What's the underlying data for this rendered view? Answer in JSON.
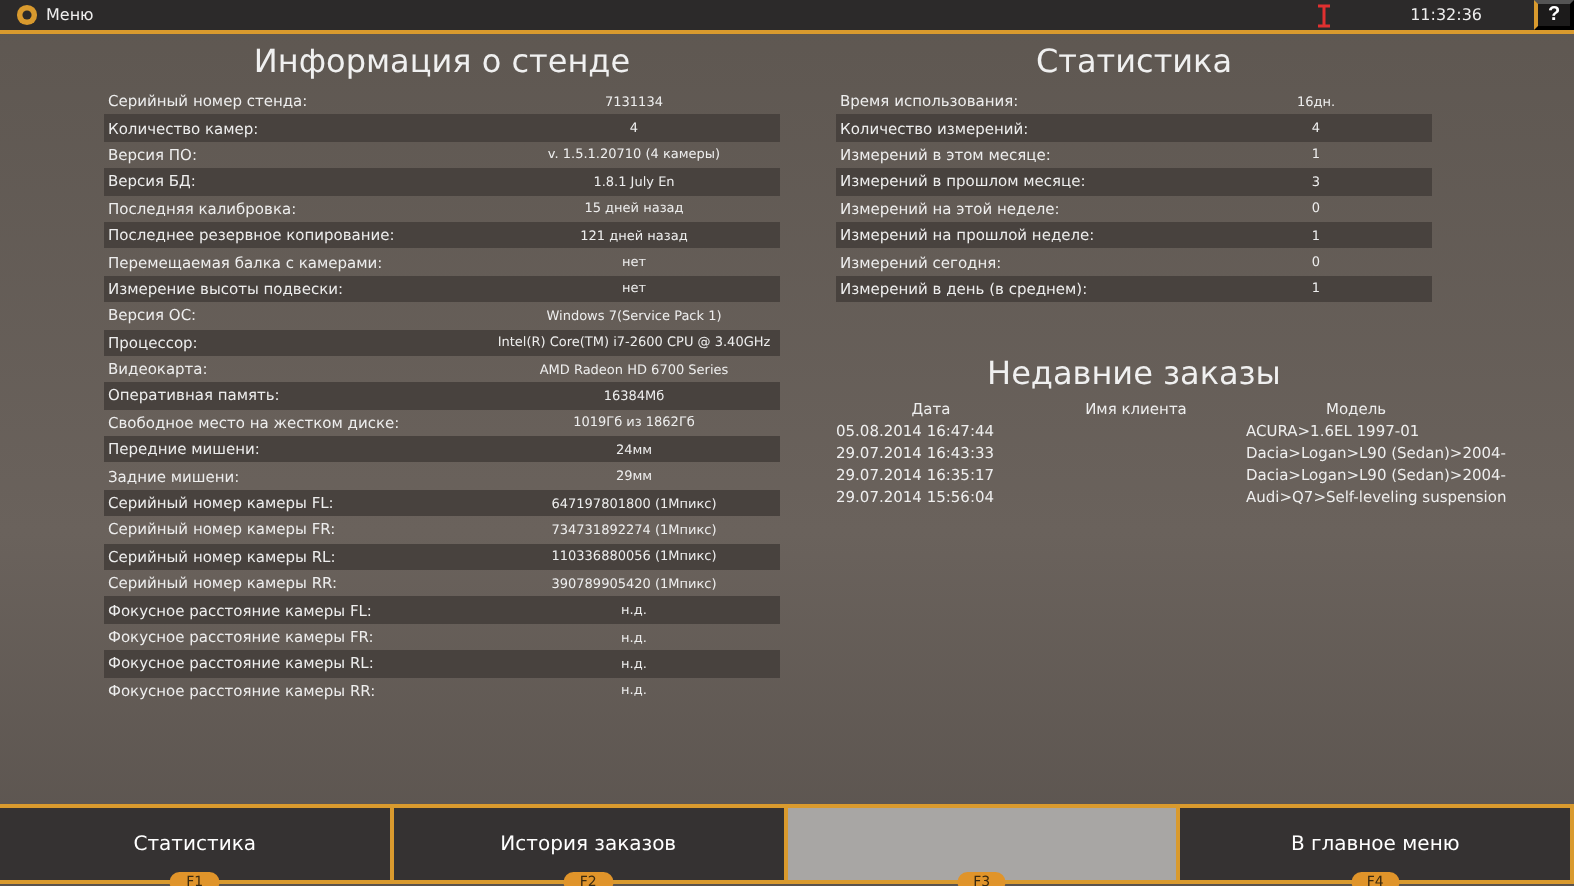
{
  "top_bar": {
    "menu_label": "Меню",
    "time": "11:32:36",
    "help": "?"
  },
  "stand_info": {
    "title": "Информация о стенде",
    "rows": [
      {
        "label": "Серийный номер стенда:",
        "value": "7131134"
      },
      {
        "label": "Количество камер:",
        "value": "4"
      },
      {
        "label": "Версия ПО:",
        "value": "v. 1.5.1.20710 (4 камеры)"
      },
      {
        "label": "Версия БД:",
        "value": "1.8.1 July En"
      },
      {
        "label": "Последняя калибровка:",
        "value": "15 дней назад"
      },
      {
        "label": "Последнее резервное копирование:",
        "value": "121 дней назад"
      },
      {
        "label": "Перемещаемая балка с камерами:",
        "value": "нет"
      },
      {
        "label": "Измерение высоты подвески:",
        "value": "нет"
      },
      {
        "label": "Версия ОС:",
        "value": "Windows 7(Service Pack 1)"
      },
      {
        "label": "Процессор:",
        "value": "Intel(R) Core(TM) i7-2600 CPU @ 3.40GHz"
      },
      {
        "label": "Видеокарта:",
        "value": "AMD Radeon HD 6700 Series"
      },
      {
        "label": "Оперативная память:",
        "value": "16384Мб"
      },
      {
        "label": "Свободное место на жестком диске:",
        "value": "1019Гб из 1862Гб"
      },
      {
        "label": "Передние мишени:",
        "value": "24мм"
      },
      {
        "label": "Задние мишени:",
        "value": "29мм"
      },
      {
        "label": "Серийный номер камеры FL:",
        "value": "647197801800 (1Мпикс)"
      },
      {
        "label": "Серийный номер камеры FR:",
        "value": "734731892274 (1Мпикс)"
      },
      {
        "label": "Серийный номер камеры RL:",
        "value": "110336880056 (1Мпикс)"
      },
      {
        "label": "Серийный номер камеры RR:",
        "value": "390789905420 (1Мпикс)"
      },
      {
        "label": "Фокусное расстояние камеры FL:",
        "value": "н.д."
      },
      {
        "label": "Фокусное расстояние камеры FR:",
        "value": "н.д."
      },
      {
        "label": "Фокусное расстояние камеры RL:",
        "value": "н.д."
      },
      {
        "label": "Фокусное расстояние камеры RR:",
        "value": "н.д."
      }
    ]
  },
  "statistics": {
    "title": "Статистика",
    "rows": [
      {
        "label": "Время использования:",
        "value": "16дн."
      },
      {
        "label": "Количество измерений:",
        "value": "4"
      },
      {
        "label": "Измерений в этом месяце:",
        "value": "1"
      },
      {
        "label": "Измерений в прошлом месяце:",
        "value": "3"
      },
      {
        "label": "Измерений на этой неделе:",
        "value": "0"
      },
      {
        "label": "Измерений на прошлой неделе:",
        "value": "1"
      },
      {
        "label": "Измерений сегодня:",
        "value": "0"
      },
      {
        "label": "Измерений в день (в среднем):",
        "value": "1"
      }
    ]
  },
  "recent_orders": {
    "title": "Недавние заказы",
    "columns": [
      "Дата",
      "Имя клиента",
      "Модель"
    ],
    "rows": [
      {
        "date": "05.08.2014 16:47:44",
        "model": "ACURA>1.6EL 1997-01"
      },
      {
        "date": "29.07.2014 16:43:33",
        "model": "Dacia>Logan>L90 (Sedan)>2004-"
      },
      {
        "date": "29.07.2014 16:35:17",
        "model": "Dacia>Logan>L90 (Sedan)>2004-"
      },
      {
        "date": "29.07.2014 15:56:04",
        "model": "Audi>Q7>Self-leveling suspension"
      }
    ]
  },
  "function_keys": [
    {
      "label": "Статистика",
      "key": "F1",
      "disabled": false
    },
    {
      "label": "История заказов",
      "key": "F2",
      "disabled": false
    },
    {
      "key": "F3",
      "disabled": true
    },
    {
      "label": "В главное меню",
      "key": "F4",
      "disabled": false
    }
  ]
}
